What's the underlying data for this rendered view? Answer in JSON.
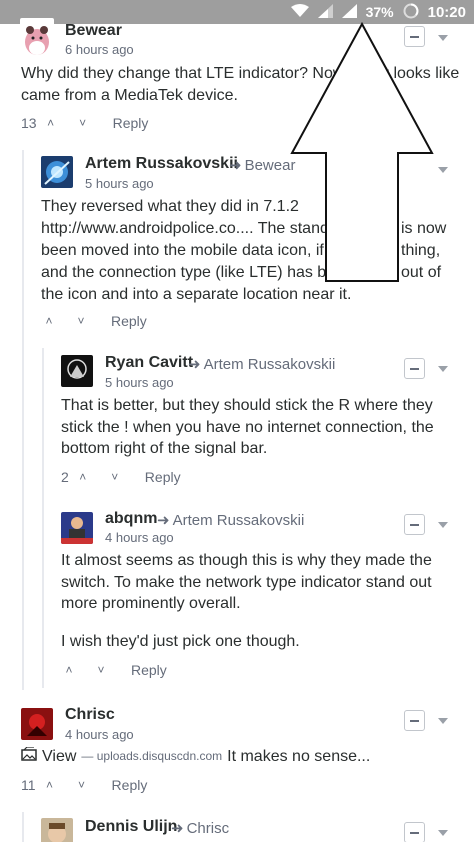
{
  "status_bar": {
    "battery": "37%",
    "time": "10:20"
  },
  "comments": [
    {
      "author": "Bewear",
      "reply_to": "",
      "time": "6 hours ago",
      "lines": [
        "Why did they change that LTE indicator? Now",
        "it looks like",
        "came from a MediaTek device."
      ],
      "upvotes": "13",
      "reply_label": "Reply"
    },
    {
      "author": "Artem Russakovskii",
      "reply_to": "Bewear",
      "time": "5 hours ago",
      "lines": [
        "They reversed what they did in 7.1.2",
        "http://www.androidpolice.co.... The stand",
        "is now",
        "been moved into the mobile data icon, if y",
        "thing,",
        "and the connection type (like LTE) has be",
        "out of",
        "the icon and into a separate location near it."
      ],
      "upvotes": "",
      "reply_label": "Reply"
    },
    {
      "author": "Ryan Cavitt",
      "reply_to": "Artem Russakovskii",
      "time": "5 hours ago",
      "lines": [
        "That is better, but they should stick the R where they",
        "stick the ! when you have no internet connection, the",
        "bottom right of the signal bar."
      ],
      "upvotes": "2",
      "reply_label": "Reply"
    },
    {
      "author": "abqnm",
      "reply_to": "Artem Russakovskii",
      "time": "4 hours ago",
      "lines": [
        "It almost seems as though this is why they made the",
        "switch. To make the network type indicator stand out",
        "more prominently overall.",
        "I wish they'd just pick one though."
      ],
      "upvotes": "",
      "reply_label": "Reply"
    },
    {
      "author": "Chrisc",
      "reply_to": "",
      "time": "4 hours ago",
      "view_label": "View",
      "view_source": "— uploads.disquscdn.com",
      "after_view": "It makes no sense...",
      "upvotes": "11",
      "reply_label": "Reply"
    },
    {
      "author": "Dennis Ulijn",
      "reply_to": "Chrisc"
    }
  ]
}
